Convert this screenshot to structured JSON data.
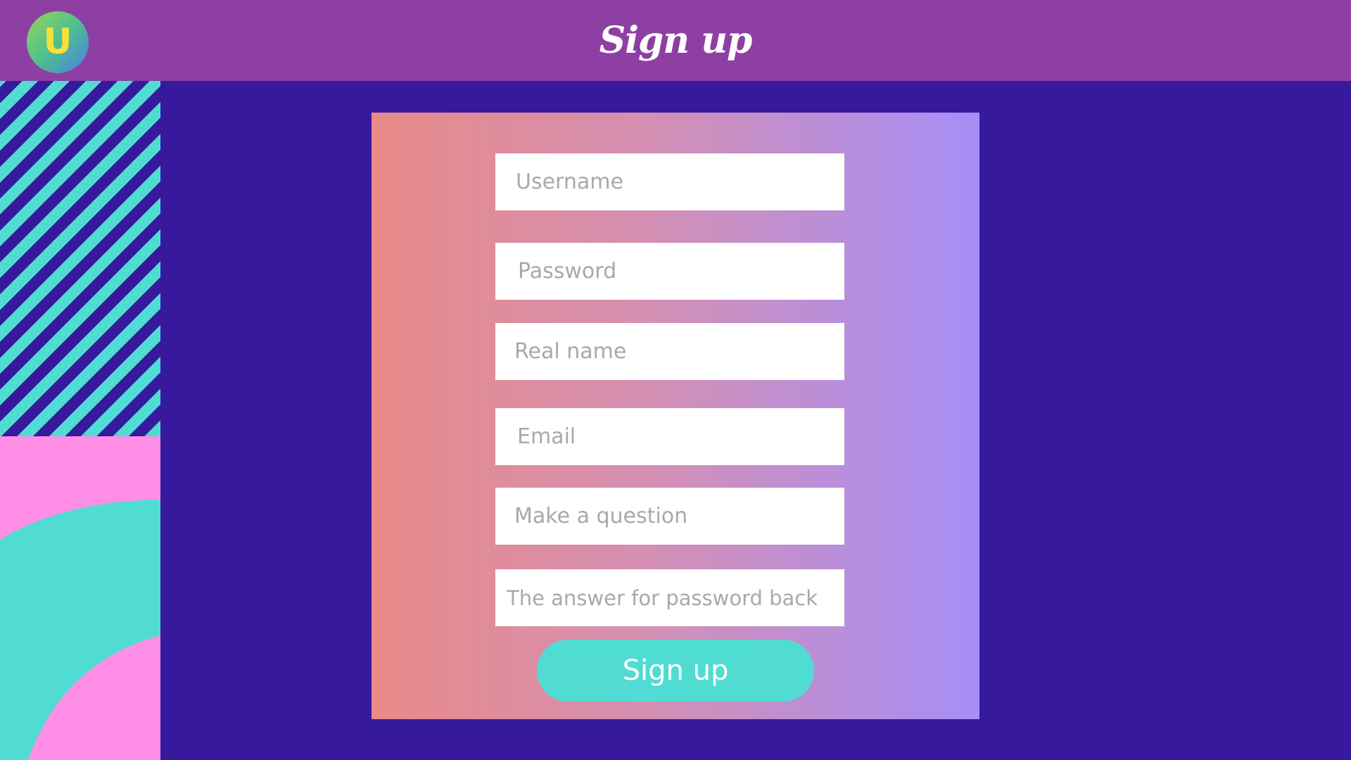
{
  "header": {
    "title": "Sign up",
    "logo_letter": "U",
    "logo_icon": "u-logo-icon"
  },
  "form": {
    "fields": [
      {
        "name": "username",
        "placeholder": "Username",
        "value": ""
      },
      {
        "name": "password",
        "placeholder": "Password",
        "value": ""
      },
      {
        "name": "real_name",
        "placeholder": "Real name",
        "value": ""
      },
      {
        "name": "email",
        "placeholder": "Email",
        "value": ""
      },
      {
        "name": "question",
        "placeholder": "Make a question",
        "value": ""
      },
      {
        "name": "answer",
        "placeholder": "The answer for password back",
        "value": ""
      }
    ],
    "submit_label": "Sign up"
  },
  "colors": {
    "header_bg": "#8e3fa3",
    "page_bg": "#37199e",
    "accent_teal": "#50dcd3",
    "accent_pink": "#ff8fe6",
    "card_gradient_start": "#e88a88",
    "card_gradient_end": "#a68ef8",
    "logo_letter": "#f7e03c"
  }
}
